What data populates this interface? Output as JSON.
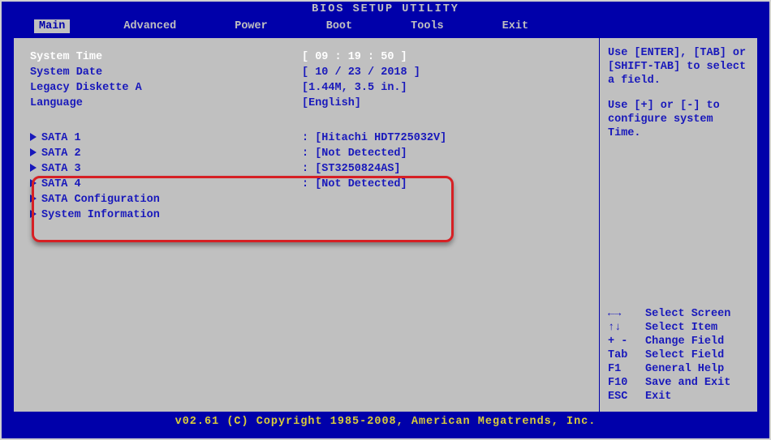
{
  "title": "BIOS SETUP UTILITY",
  "menu": {
    "items": [
      {
        "label": "Main",
        "selected": true
      },
      {
        "label": "Advanced",
        "selected": false
      },
      {
        "label": "Power",
        "selected": false
      },
      {
        "label": "Boot",
        "selected": false
      },
      {
        "label": "Tools",
        "selected": false
      },
      {
        "label": "Exit",
        "selected": false
      }
    ]
  },
  "main": {
    "system_time": {
      "label": "System Time",
      "value": "[ 09 : 19 : 50 ]"
    },
    "system_date": {
      "label": "System Date",
      "value": "[ 10 / 23 / 2018 ]"
    },
    "legacy_diskette_a": {
      "label": "Legacy Diskette A",
      "value": "[1.44M, 3.5 in.]"
    },
    "language": {
      "label": "Language",
      "value": "[English]"
    },
    "sata1": {
      "label": "SATA 1",
      "value": ": [Hitachi HDT725032V]"
    },
    "sata2": {
      "label": "SATA 2",
      "value": ": [Not Detected]"
    },
    "sata3": {
      "label": "SATA 3",
      "value": ": [ST3250824AS]"
    },
    "sata4": {
      "label": "SATA 4",
      "value": ": [Not Detected]"
    },
    "sata_config": {
      "label": "SATA Configuration"
    },
    "system_info": {
      "label": "System Information"
    }
  },
  "help": {
    "hint1": "Use [ENTER], [TAB] or [SHIFT-TAB] to select a field.",
    "hint2": "Use [+] or [-] to configure system Time.",
    "keys": {
      "lr": {
        "k": "←→",
        "d": "Select Screen"
      },
      "ud": {
        "k": "↑↓",
        "d": "Select Item"
      },
      "pm": {
        "k": "+ -",
        "d": "Change Field"
      },
      "tab": {
        "k": "Tab",
        "d": "Select Field"
      },
      "f1": {
        "k": "F1",
        "d": "General Help"
      },
      "f10": {
        "k": "F10",
        "d": "Save and Exit"
      },
      "esc": {
        "k": "ESC",
        "d": "Exit"
      }
    }
  },
  "footer": "v02.61 (C) Copyright 1985-2008, American Megatrends, Inc."
}
